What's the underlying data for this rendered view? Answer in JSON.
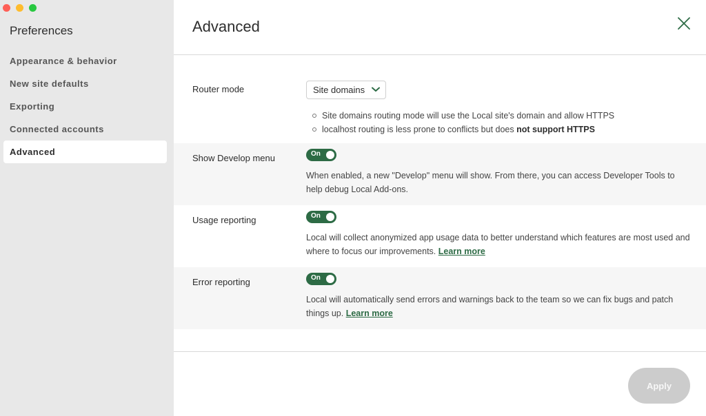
{
  "sidebar": {
    "title": "Preferences",
    "items": [
      {
        "label": "Appearance & behavior",
        "active": false
      },
      {
        "label": "New site defaults",
        "active": false
      },
      {
        "label": "Exporting",
        "active": false
      },
      {
        "label": "Connected accounts",
        "active": false
      },
      {
        "label": "Advanced",
        "active": true
      }
    ]
  },
  "header": {
    "title": "Advanced",
    "close_icon": "close-icon"
  },
  "router": {
    "label": "Router mode",
    "selected": "Site domains",
    "bullets": [
      {
        "text": "Site domains routing mode will use the Local site's domain and allow HTTPS",
        "bold": ""
      },
      {
        "text": "localhost routing is less prone to conflicts but does ",
        "bold": "not support HTTPS"
      }
    ]
  },
  "develop_menu": {
    "label": "Show Develop menu",
    "toggle": "On",
    "description": "When enabled, a new \"Develop\" menu will show. From there, you can access Developer Tools to help debug Local Add-ons."
  },
  "usage_reporting": {
    "label": "Usage reporting",
    "toggle": "On",
    "description": "Local will collect anonymized app usage data to better understand which features are most used and where to focus our improvements. ",
    "link": "Learn more"
  },
  "error_reporting": {
    "label": "Error reporting",
    "toggle": "On",
    "description": "Local will automatically send errors and warnings back to the team so we can fix bugs and patch things up. ",
    "link": "Learn more"
  },
  "footer": {
    "apply_label": "Apply"
  },
  "colors": {
    "accent": "#2d6b45",
    "sidebar_bg": "#e8e8e8",
    "apply_disabled": "#cccccc"
  }
}
